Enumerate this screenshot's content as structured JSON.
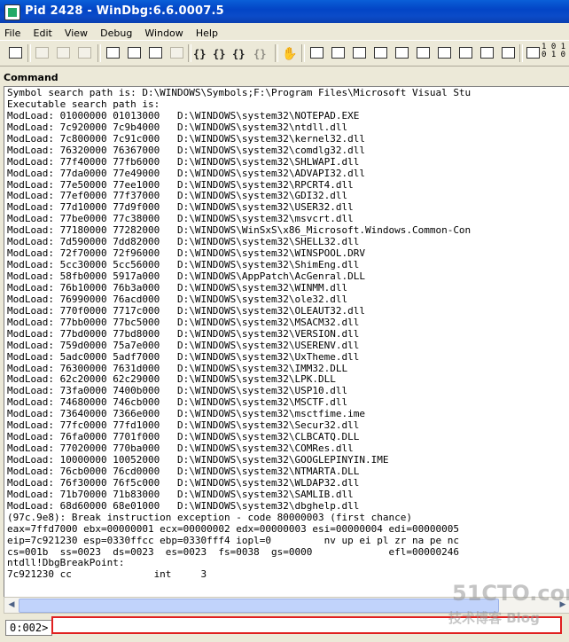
{
  "window": {
    "title": "Pid 2428 - WinDbg:6.6.0007.5"
  },
  "menu": [
    "File",
    "Edit",
    "View",
    "Debug",
    "Window",
    "Help"
  ],
  "toolbar": {
    "hex_label_line1": "1 0 1",
    "hex_label_line2": "0 1 0"
  },
  "command_window": {
    "title": "Command",
    "lines": [
      "Symbol search path is: D:\\WINDOWS\\Symbols;F:\\Program Files\\Microsoft Visual Stu",
      "Executable search path is:",
      "ModLoad: 01000000 01013000   D:\\WINDOWS\\system32\\NOTEPAD.EXE",
      "ModLoad: 7c920000 7c9b4000   D:\\WINDOWS\\system32\\ntdll.dll",
      "ModLoad: 7c800000 7c91c000   D:\\WINDOWS\\system32\\kernel32.dll",
      "ModLoad: 76320000 76367000   D:\\WINDOWS\\system32\\comdlg32.dll",
      "ModLoad: 77f40000 77fb6000   D:\\WINDOWS\\system32\\SHLWAPI.dll",
      "ModLoad: 77da0000 77e49000   D:\\WINDOWS\\system32\\ADVAPI32.dll",
      "ModLoad: 77e50000 77ee1000   D:\\WINDOWS\\system32\\RPCRT4.dll",
      "ModLoad: 77ef0000 77f37000   D:\\WINDOWS\\system32\\GDI32.dll",
      "ModLoad: 77d10000 77d9f000   D:\\WINDOWS\\system32\\USER32.dll",
      "ModLoad: 77be0000 77c38000   D:\\WINDOWS\\system32\\msvcrt.dll",
      "ModLoad: 77180000 77282000   D:\\WINDOWS\\WinSxS\\x86_Microsoft.Windows.Common-Con",
      "ModLoad: 7d590000 7dd82000   D:\\WINDOWS\\system32\\SHELL32.dll",
      "ModLoad: 72f70000 72f96000   D:\\WINDOWS\\system32\\WINSPOOL.DRV",
      "ModLoad: 5cc30000 5cc56000   D:\\WINDOWS\\system32\\ShimEng.dll",
      "ModLoad: 58fb0000 5917a000   D:\\WINDOWS\\AppPatch\\AcGenral.DLL",
      "ModLoad: 76b10000 76b3a000   D:\\WINDOWS\\system32\\WINMM.dll",
      "ModLoad: 76990000 76acd000   D:\\WINDOWS\\system32\\ole32.dll",
      "ModLoad: 770f0000 7717c000   D:\\WINDOWS\\system32\\OLEAUT32.dll",
      "ModLoad: 77bb0000 77bc5000   D:\\WINDOWS\\system32\\MSACM32.dll",
      "ModLoad: 77bd0000 77bd8000   D:\\WINDOWS\\system32\\VERSION.dll",
      "ModLoad: 759d0000 75a7e000   D:\\WINDOWS\\system32\\USERENV.dll",
      "ModLoad: 5adc0000 5adf7000   D:\\WINDOWS\\system32\\UxTheme.dll",
      "ModLoad: 76300000 7631d000   D:\\WINDOWS\\system32\\IMM32.DLL",
      "ModLoad: 62c20000 62c29000   D:\\WINDOWS\\system32\\LPK.DLL",
      "ModLoad: 73fa0000 7400b000   D:\\WINDOWS\\system32\\USP10.dll",
      "ModLoad: 74680000 746cb000   D:\\WINDOWS\\system32\\MSCTF.dll",
      "ModLoad: 73640000 7366e000   D:\\WINDOWS\\system32\\msctfime.ime",
      "ModLoad: 77fc0000 77fd1000   D:\\WINDOWS\\system32\\Secur32.dll",
      "ModLoad: 76fa0000 7701f000   D:\\WINDOWS\\system32\\CLBCATQ.DLL",
      "ModLoad: 77020000 770ba000   D:\\WINDOWS\\system32\\COMRes.dll",
      "ModLoad: 10000000 10052000   D:\\WINDOWS\\system32\\GOOGLEPINYIN.IME",
      "ModLoad: 76cb0000 76cd0000   D:\\WINDOWS\\system32\\NTMARTA.DLL",
      "ModLoad: 76f30000 76f5c000   D:\\WINDOWS\\system32\\WLDAP32.dll",
      "ModLoad: 71b70000 71b83000   D:\\WINDOWS\\system32\\SAMLIB.dll",
      "ModLoad: 68d60000 68e01000   D:\\WINDOWS\\system32\\dbghelp.dll",
      "(97c.9e8): Break instruction exception - code 80000003 (first chance)",
      "eax=7ffd7000 ebx=00000001 ecx=00000002 edx=00000003 esi=00000004 edi=00000005",
      "eip=7c921230 esp=0330ffcc ebp=0330fff4 iopl=0         nv up ei pl zr na pe nc",
      "cs=001b  ss=0023  ds=0023  es=0023  fs=0038  gs=0000             efl=00000246",
      "ntdll!DbgBreakPoint:",
      "7c921230 cc              int     3"
    ],
    "prompt": "0:002>",
    "input_value": ""
  },
  "watermark": {
    "line1": "51CTO.com",
    "line2": "技术博客  Blog"
  }
}
